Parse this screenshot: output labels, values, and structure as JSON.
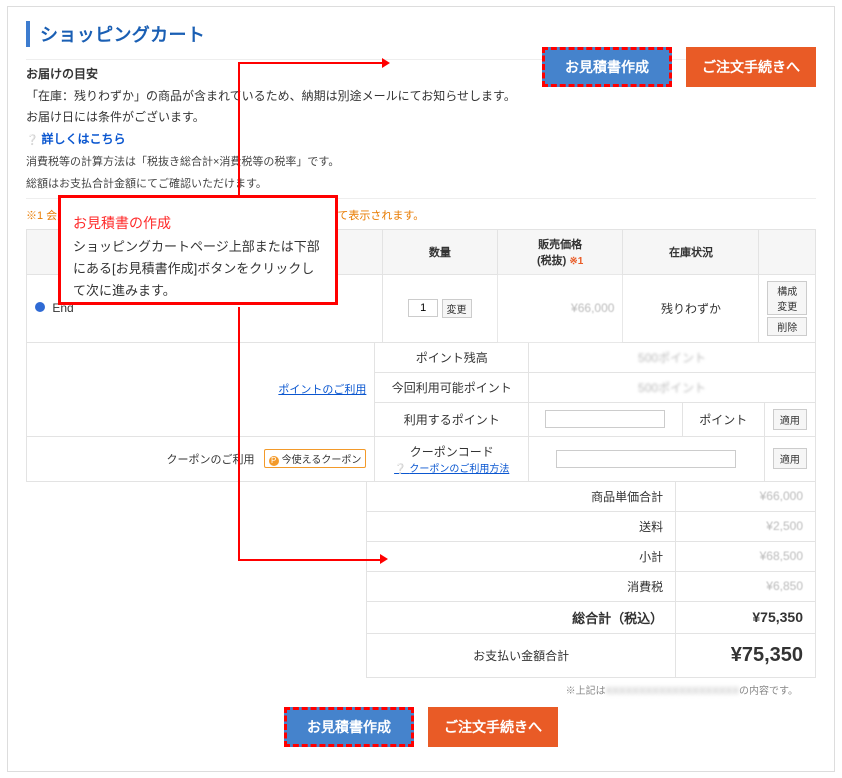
{
  "page": {
    "title": "ショッピングカート"
  },
  "info": {
    "heading": "お届けの目安",
    "line1": "「在庫：残りわずか」の商品が含まれているため、納期は別途メールにてお知らせします。",
    "line2": "お届け日には条件がございます。",
    "details_link": "詳しくはこちら",
    "note1": "消費税等の計算方法は「税抜き総合計×消費税等の税率」です。",
    "note2": "総額はお支払合計金額にてご確認いただけます。",
    "orange": "※1 会員特典の値引きが適用された場合は、「会員値引き」として表示されます。"
  },
  "buttons": {
    "quote": "お見積書作成",
    "checkout": "ご注文手続きへ"
  },
  "cart": {
    "col_qty": "数量",
    "col_price_l1": "販売価格",
    "col_price_l2": "(税抜)",
    "col_price_star": "※1",
    "col_stock": "在庫状況",
    "product_name": "End",
    "qty_value": "1",
    "change_btn": "変更",
    "price": "¥66,000",
    "stock": "残りわずか",
    "edit_btn_1": "構成変更",
    "edit_btn_2": "削除"
  },
  "points": {
    "left_link": "ポイントのご利用",
    "row1_label": "ポイント残高",
    "row1_val": "500ポイント",
    "row2_label": "今回利用可能ポイント",
    "row2_val": "500ポイント",
    "row3_label": "利用するポイント",
    "row3_unit": "ポイント",
    "apply": "適用"
  },
  "coupon": {
    "left_label": "クーポンのご利用",
    "chip": "今使えるクーポン",
    "row_label": "クーポンコード",
    "row_link": "クーポンのご利用方法",
    "apply": "適用"
  },
  "totals": {
    "unit_label": "商品単価合計",
    "unit_val": "¥66,000",
    "ship_label": "送料",
    "ship_val": "¥2,500",
    "sub_label": "小計",
    "sub_val": "¥68,500",
    "tax_label": "消費税",
    "tax_val": "¥6,850",
    "grand_label": "総合計（税込）",
    "grand_val": "¥75,350",
    "pay_label": "お支払い金額合計",
    "pay_val": "¥75,350",
    "footnote_prefix": "※上記は",
    "footnote_suffix": "の内容です。"
  },
  "instruction": {
    "title": "お見積書の作成",
    "body": "ショッピングカートページ上部または下部にある[お見積書作成]ボタンをクリックして次に進みます。"
  }
}
